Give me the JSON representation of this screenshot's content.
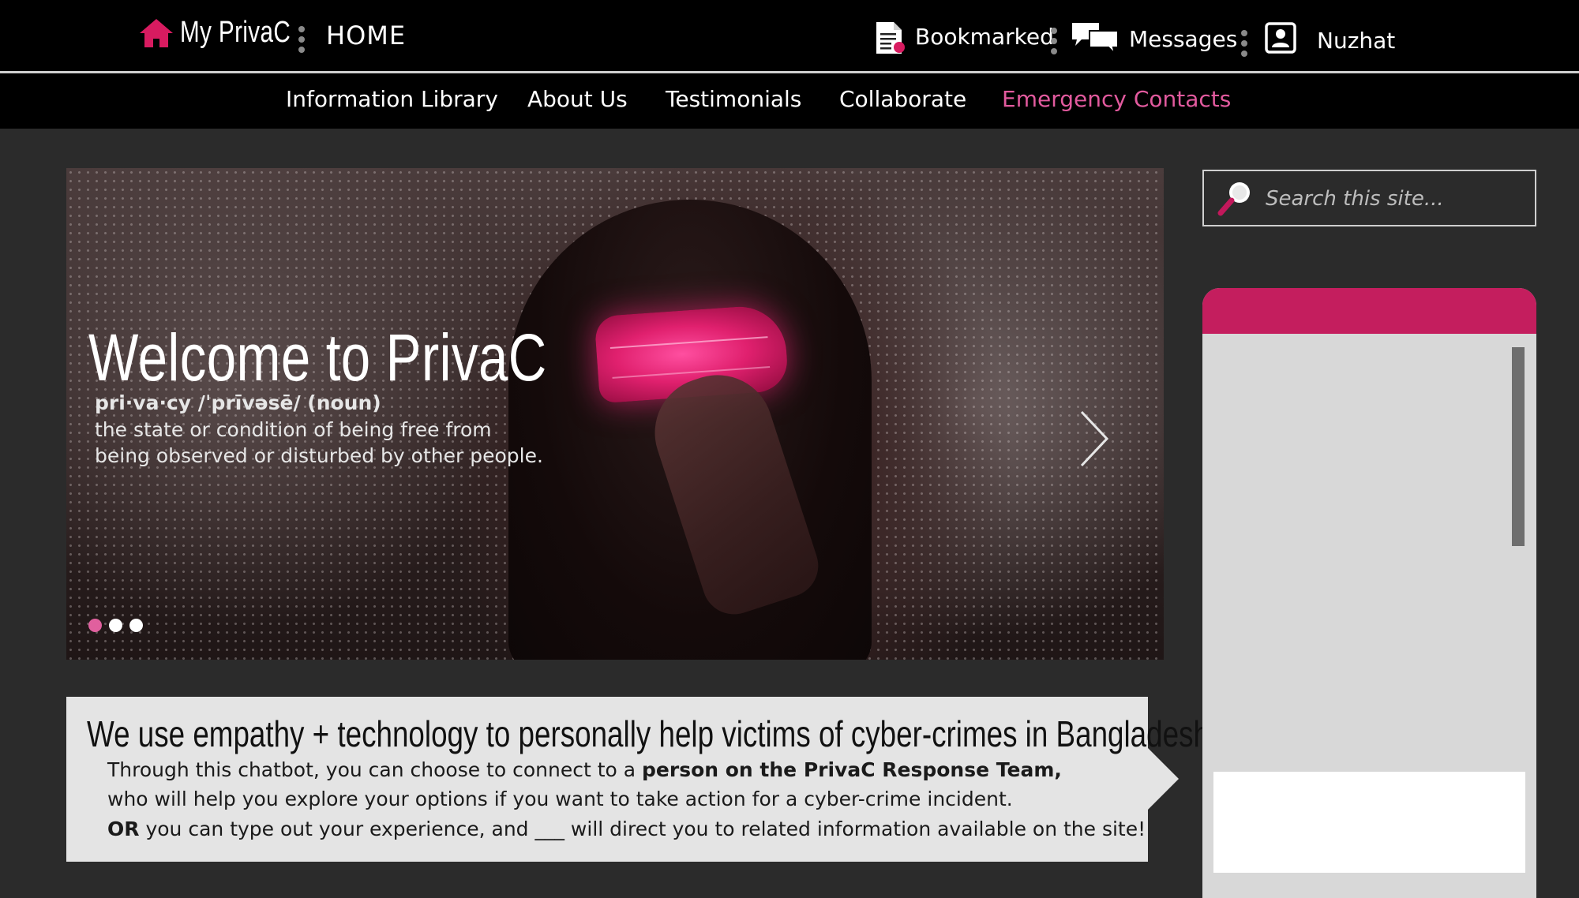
{
  "header": {
    "brand": "My PrivaC",
    "home_label": "HOME",
    "bookmarked_label": "Bookmarked",
    "messages_label": "Messages",
    "user_name": "Nuzhat"
  },
  "nav": {
    "items": [
      {
        "label": "Information Library"
      },
      {
        "label": "About Us"
      },
      {
        "label": "Testimonials"
      },
      {
        "label": "Collaborate"
      },
      {
        "label": "Emergency Contacts",
        "active": true
      }
    ]
  },
  "hero": {
    "title": "Welcome to PrivaC",
    "definition_term": "pri·va·cy /ˈprīvəsē/ (noun)",
    "definition_line1": "the state or condition of being free from",
    "definition_line2": "being observed or disturbed by other people.",
    "slide_count": 3,
    "active_slide": 1
  },
  "callout": {
    "headline": "We use empathy + technology to personally help victims of cyber-crimes in Bangladesh.",
    "line1_prefix": "Through this chatbot, you can choose to connect to a ",
    "line1_bold": "person on the PrivaC Response Team,",
    "line2": "who will help you explore your options if you want to take action for a cyber-crime incident.",
    "line3_bold": "OR",
    "line3_rest": " you can type out your experience, and ___ will direct you to related information available on the site!"
  },
  "search": {
    "placeholder": "Search this site..."
  },
  "colors": {
    "accent": "#c41e5e",
    "nav_active": "#e25a9e",
    "background": "#2b2b2b",
    "topbar": "#000000"
  },
  "icons": {
    "home": "home-icon",
    "bookmarked": "document-icon",
    "messages": "chat-bubbles-icon",
    "user": "user-profile-icon",
    "search": "magnifier-icon",
    "next": "chevron-right-icon"
  }
}
